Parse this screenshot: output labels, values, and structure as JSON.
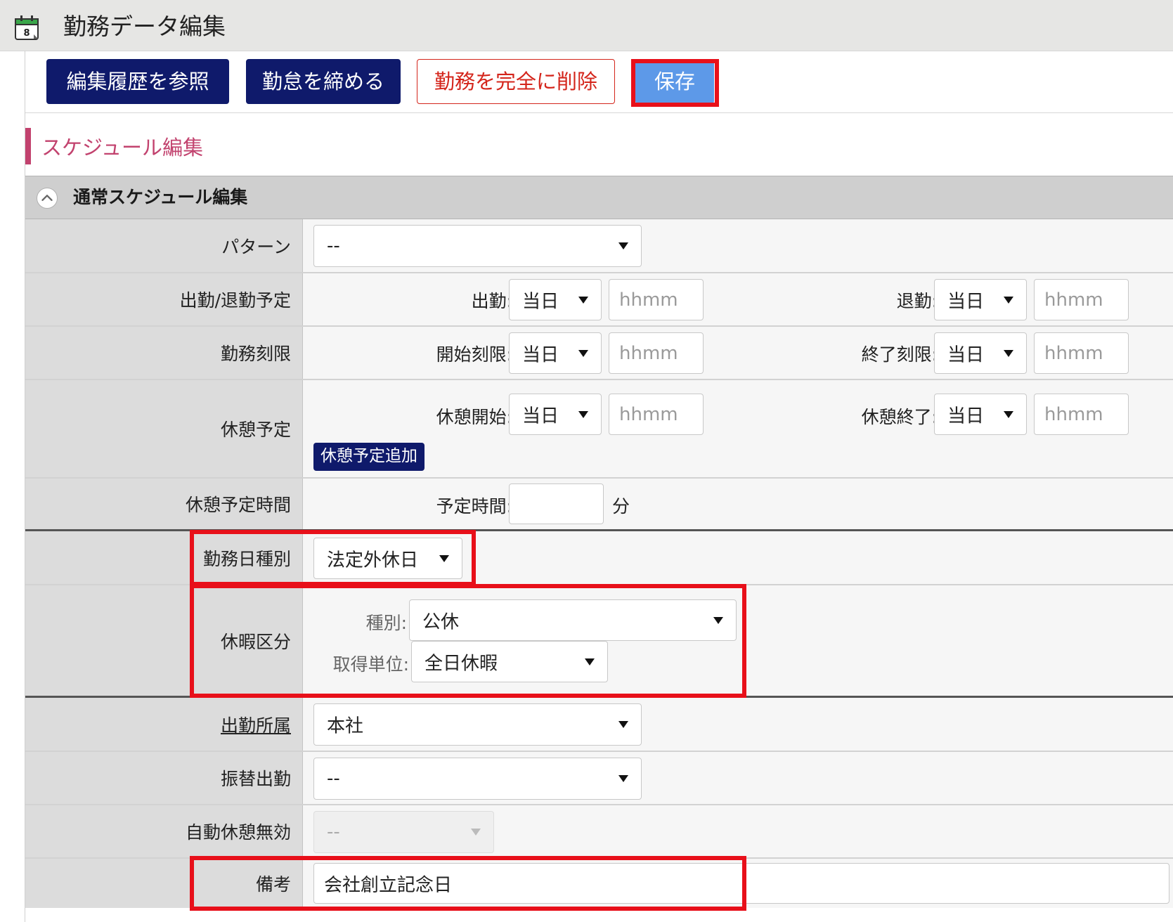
{
  "window": {
    "title": "勤務データ編集",
    "icon": "calendar-icon"
  },
  "toolbar": {
    "history_label": "編集履歴を参照",
    "close_label": "勤怠を締める",
    "delete_label": "勤務を完全に削除",
    "save_label": "保存"
  },
  "section": {
    "title": "スケジュール編集"
  },
  "panel": {
    "title": "通常スケジュール編集",
    "collapse_icon": "chevron-up-icon"
  },
  "form": {
    "pattern": {
      "label": "パターン",
      "value": "--"
    },
    "shift": {
      "label": "出勤/退勤予定",
      "start_label": "出勤:",
      "start_day": "当日",
      "start_time_placeholder": "hhmm",
      "end_label": "退勤:",
      "end_day": "当日",
      "end_time_placeholder": "hhmm"
    },
    "time_limit": {
      "label": "勤務刻限",
      "start_label": "開始刻限:",
      "start_day": "当日",
      "start_time_placeholder": "hhmm",
      "end_label": "終了刻限:",
      "end_day": "当日",
      "end_time_placeholder": "hhmm"
    },
    "break_plan": {
      "label": "休憩予定",
      "start_label": "休憩開始:",
      "start_day": "当日",
      "start_time_placeholder": "hhmm",
      "end_label": "休憩終了:",
      "end_day": "当日",
      "end_time_placeholder": "hhmm",
      "add_button": "休憩予定追加"
    },
    "break_duration": {
      "label": "休憩予定時間",
      "field_label": "予定時間:",
      "unit": "分",
      "value": ""
    },
    "day_type": {
      "label": "勤務日種別",
      "value": "法定外休日"
    },
    "leave": {
      "label": "休暇区分",
      "type_label": "種別:",
      "type_value": "公休",
      "unit_label": "取得単位:",
      "unit_value": "全日休暇"
    },
    "office": {
      "label": "出勤所属",
      "value": "本社"
    },
    "substitute": {
      "label": "振替出勤",
      "value": "--"
    },
    "auto_break": {
      "label": "自動休憩無効",
      "value": "--"
    },
    "note": {
      "label": "備考",
      "value": "会社創立記念日"
    }
  },
  "colors": {
    "navy_button": "#0f1a6b",
    "save_button": "#5d99e8",
    "danger": "#d4251b",
    "section_accent": "#c2426e",
    "highlight_box": "#e8101a"
  }
}
